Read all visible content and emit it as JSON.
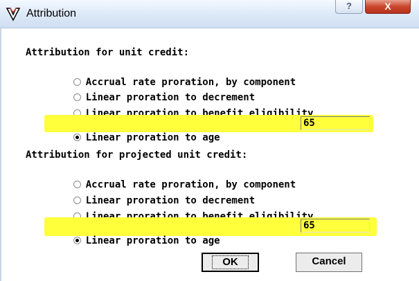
{
  "window": {
    "title": "Attribution",
    "help_glyph": "?",
    "close_glyph": "X",
    "icon": "attribution-app-icon"
  },
  "unit_credit": {
    "label": "Attribution for unit credit:",
    "options": [
      {
        "label": "Accrual rate proration, by component",
        "checked": false
      },
      {
        "label": "Linear proration to decrement",
        "checked": false
      },
      {
        "label": "Linear proration to benefit eligibility",
        "checked": false
      },
      {
        "label": "Linear proration to age",
        "checked": true
      }
    ],
    "age_value": "65"
  },
  "projected_unit_credit": {
    "label": "Attribution for projected unit credit:",
    "options": [
      {
        "label": "Accrual rate proration, by component",
        "checked": false
      },
      {
        "label": "Linear proration to decrement",
        "checked": false
      },
      {
        "label": "Linear proration to benefit eligibility",
        "checked": false
      },
      {
        "label": "Linear proration to age",
        "checked": true
      }
    ],
    "age_value": "65"
  },
  "buttons": {
    "ok_label": "OK",
    "cancel_label": "Cancel"
  },
  "colors": {
    "highlight": "#ffff3c",
    "close_button": "#c9462c"
  }
}
